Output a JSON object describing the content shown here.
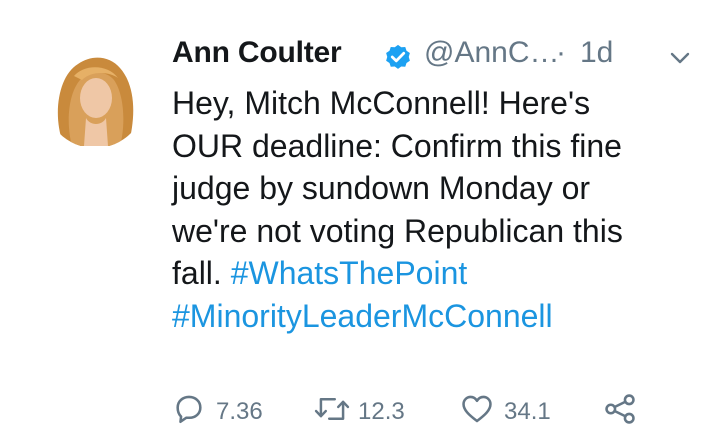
{
  "tweet": {
    "author": {
      "display_name": "Ann Coulter",
      "handle": "@AnnC…",
      "verified": true
    },
    "separator": "·",
    "timestamp": "1d",
    "text_lines": [
      "Hey, Mitch McConnell!  Here's",
      "OUR deadline: Confirm this fine",
      "judge by sundown Monday or",
      "we're not voting Republican this",
      "fall. "
    ],
    "hashtags": [
      "#WhatsThePoint",
      "#MinorityLeaderMcConnell"
    ],
    "actions": {
      "reply_count": "7.36",
      "retweet_count": "12.3",
      "like_count": "34.1"
    }
  },
  "colors": {
    "accent": "#1b95e0",
    "muted": "#657786",
    "text": "#14171a"
  },
  "icons": {
    "verified": "verified-badge-icon",
    "caret": "chevron-down-icon",
    "reply": "reply-icon",
    "retweet": "retweet-icon",
    "like": "heart-icon",
    "share": "share-icon"
  }
}
